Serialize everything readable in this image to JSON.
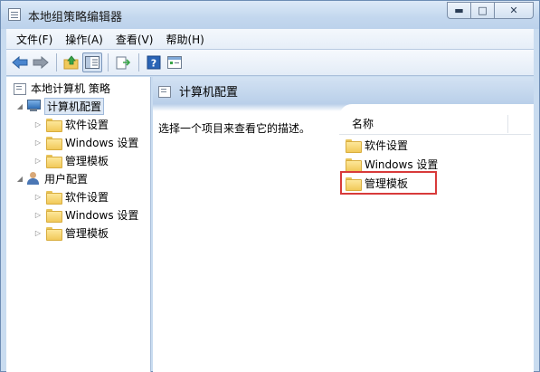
{
  "window": {
    "title": "本地组策略编辑器",
    "caption": {
      "minimize": "▬",
      "maximize": "□",
      "close": "✕"
    }
  },
  "menu": [
    {
      "label": "文件(F)"
    },
    {
      "label": "操作(A)"
    },
    {
      "label": "查看(V)"
    },
    {
      "label": "帮助(H)"
    }
  ],
  "toolbar": {
    "icons": [
      "back-arrow-icon",
      "forward-arrow-icon",
      "up-folder-icon",
      "show-hide-tree-icon",
      "export-list-icon",
      "help-icon",
      "properties-icon"
    ],
    "help_glyph": "?"
  },
  "tree": {
    "root": "本地计算机 策略",
    "computer_config": "计算机配置",
    "user_config": "用户配置",
    "children": [
      "软件设置",
      "Windows 设置",
      "管理模板"
    ],
    "user_children": [
      "软件设置",
      "Windows 设置",
      "管理模板"
    ]
  },
  "right_pane": {
    "header": "计算机配置",
    "description": "选择一个项目来查看它的描述。",
    "column_name": "名称",
    "items": [
      "软件设置",
      "Windows 设置",
      "管理模板"
    ]
  },
  "colors": {
    "accent": "#c9dcf0",
    "highlight": "#d83a3a",
    "folder": "#f1c95a"
  }
}
